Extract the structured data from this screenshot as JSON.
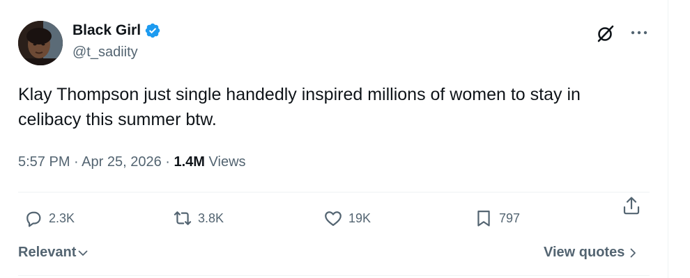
{
  "author": {
    "display_name": "Black Girl",
    "handle": "@t_sadiity",
    "verified": true
  },
  "tweet": {
    "text": "Klay Thompson just single handedly inspired millions of women to stay in celibacy this summer btw.",
    "time": "5:57 PM",
    "separator": "·",
    "date": "Apr 25, 2026",
    "views_count": "1.4M",
    "views_label": "Views"
  },
  "actions": {
    "replies": "2.3K",
    "reposts": "3.8K",
    "likes": "19K",
    "bookmarks": "797"
  },
  "footer": {
    "sort_label": "Relevant",
    "view_quotes_label": "View quotes"
  },
  "icons": {
    "verified": "verified-badge-icon",
    "grok": "grok-icon",
    "more": "more-icon",
    "reply": "reply-icon",
    "repost": "repost-icon",
    "like": "heart-icon",
    "bookmark": "bookmark-icon",
    "share": "share-icon"
  },
  "colors": {
    "verified_blue": "#1d9bf0",
    "text_primary": "#0f1419",
    "text_secondary": "#536471",
    "divider": "#eff3f4"
  }
}
